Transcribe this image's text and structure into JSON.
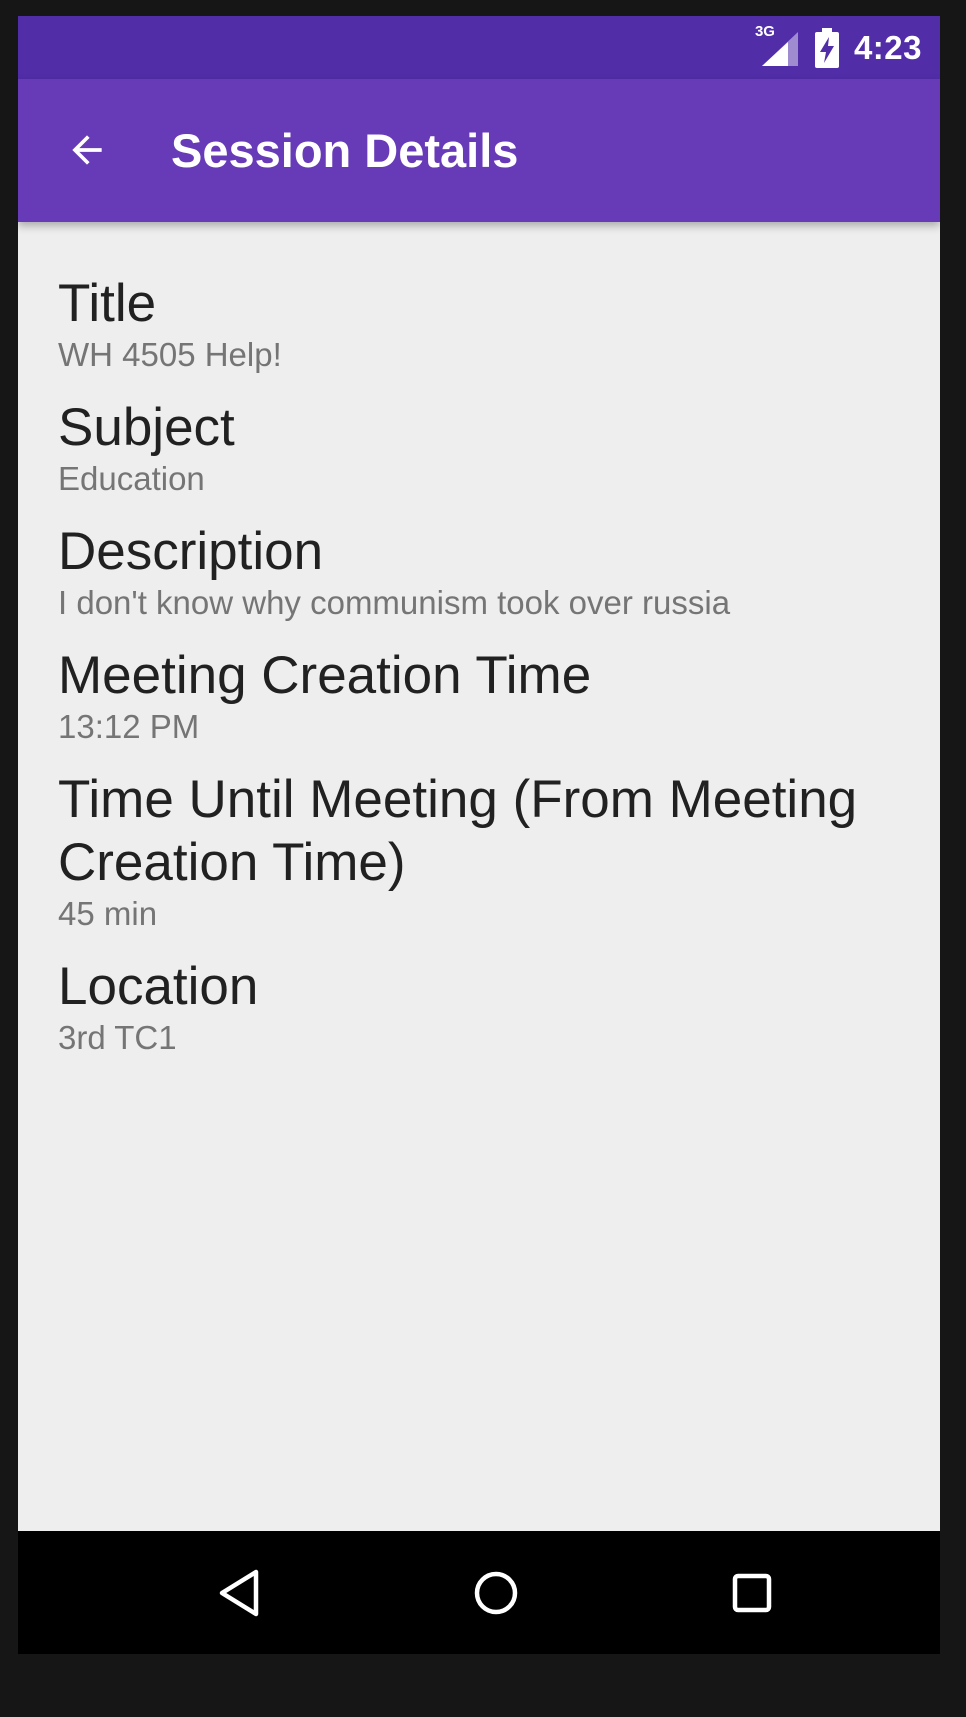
{
  "status_bar": {
    "network": "3G",
    "time": "4:23"
  },
  "app_bar": {
    "title": "Session Details",
    "back_icon": "arrow-back-icon"
  },
  "fields": {
    "title": {
      "label": "Title",
      "value": "WH 4505 Help!"
    },
    "subject": {
      "label": "Subject",
      "value": "Education"
    },
    "description": {
      "label": "Description",
      "value": "I don't know why communism took over russia"
    },
    "creation_time": {
      "label": "Meeting Creation Time",
      "value": "13:12 PM"
    },
    "time_until": {
      "label": "Time Until Meeting (From Meeting Creation Time)",
      "value": "45 min"
    },
    "location": {
      "label": "Location",
      "value": "3rd TC1"
    }
  },
  "nav_bar": {
    "back_icon": "nav-back-icon",
    "home_icon": "nav-home-icon",
    "recents_icon": "nav-recents-icon"
  },
  "colors": {
    "status_bar": "#512da8",
    "app_bar": "#673ab7",
    "background": "#eeeeee",
    "label_text": "#212121",
    "value_text": "#757575"
  }
}
